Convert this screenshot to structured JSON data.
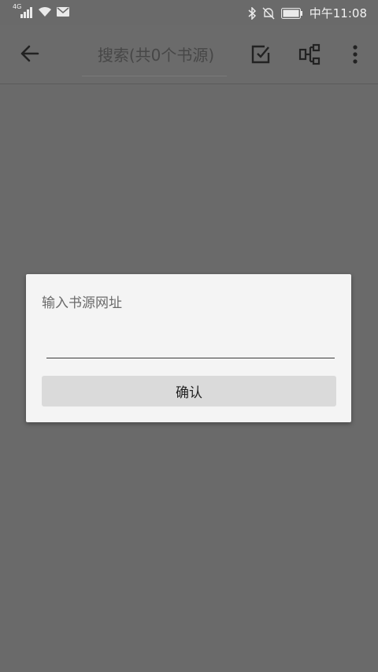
{
  "status_bar": {
    "network": "4G",
    "time": "中午11:08"
  },
  "toolbar": {
    "search_placeholder": "搜索(共0个书源)"
  },
  "dialog": {
    "title": "输入书源网址",
    "url_value": "",
    "confirm_label": "确认"
  }
}
